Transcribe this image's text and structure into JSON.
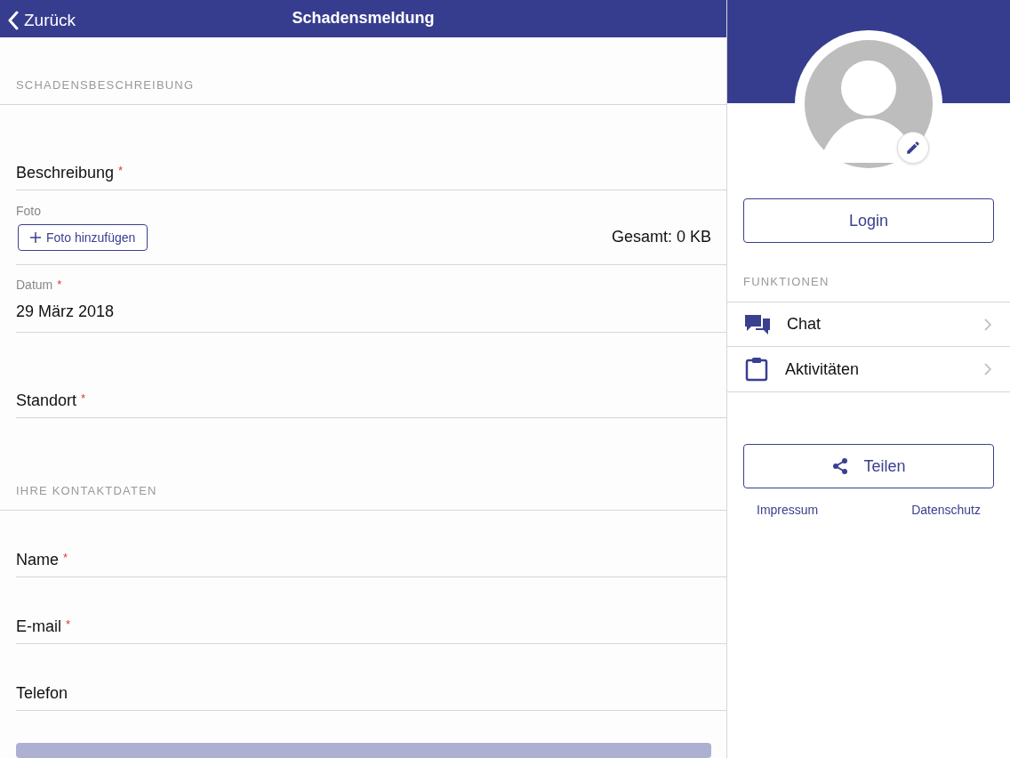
{
  "nav_bar": {
    "back": "Zurück",
    "title": "Schadensmeldung"
  },
  "sections": [
    {
      "title": "SCHADENSBESCHREIBUNG",
      "fields": [
        {
          "kind": "text",
          "label": "Beschreibung",
          "required_mark": "*"
        },
        {
          "kind": "photo",
          "label": "Foto",
          "button": "Foto hinzufügen",
          "total": "Gesamt: 0 KB"
        },
        {
          "kind": "date",
          "label": "Datum",
          "required_mark": "*",
          "value": "29 März 2018"
        },
        {
          "kind": "text",
          "label": "Standort",
          "required_mark": "*"
        }
      ]
    },
    {
      "title": "IHRE KONTAKTDATEN",
      "fields": [
        {
          "kind": "text",
          "label": "Name",
          "required_mark": "*"
        },
        {
          "kind": "text",
          "label": "E-mail",
          "required_mark": "*"
        },
        {
          "kind": "text",
          "label": "Telefon"
        }
      ]
    }
  ],
  "sidebar": {
    "login": "Login",
    "functions_title": "FUNKTIONEN",
    "items": [
      {
        "kind": "chat",
        "label": "Chat"
      },
      {
        "kind": "clipboard",
        "label": "Aktivitäten"
      }
    ],
    "share": "Teilen",
    "links": [
      "Impressum",
      "Datenschutz"
    ]
  }
}
